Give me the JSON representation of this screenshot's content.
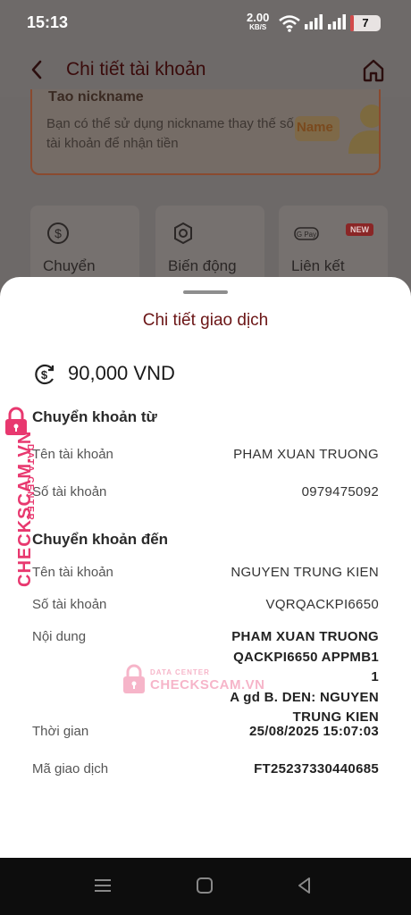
{
  "status_bar": {
    "time": "15:13",
    "speed_value": "2.00",
    "speed_unit": "KB/S",
    "battery": "7",
    "battery_level": 0.07,
    "icons": [
      "wifi-icon",
      "signal-icon",
      "signal-icon",
      "battery-icon"
    ]
  },
  "header": {
    "title": "Chi tiết tài khoản",
    "back_icon": "back-arrow-icon",
    "home_icon": "home-icon"
  },
  "background": {
    "nickname_card": {
      "partial_title": "Tạo nickname",
      "description": "Bạn có thể sử dụng nickname thay thế số tài khoản để nhận tiền",
      "badge": "Name"
    },
    "services": [
      {
        "label": "Chuyển",
        "icon": "transfer-icon"
      },
      {
        "label": "Biến động",
        "icon": "settings-icon"
      },
      {
        "label": "Liên kết",
        "icon": "gpay-icon",
        "badge": "NEW"
      }
    ]
  },
  "sheet": {
    "title": "Chi tiết giao dịch",
    "amount": "90,000 VND",
    "from_section": "Chuyển khoản từ",
    "from_name_label": "Tên tài khoản",
    "from_name": "PHAM XUAN TRUONG",
    "from_account_label": "Số tài khoản",
    "from_account": "0979475092",
    "to_section": "Chuyển khoản đến",
    "to_name_label": "Tên tài khoản",
    "to_name": "NGUYEN TRUNG KIEN",
    "to_account_label": "Số tài khoản",
    "to_account": "VQRQACKPI6650",
    "memo_label": "Nội dung",
    "memo_lines": [
      "PHAM XUAN TRUONG",
      "QACKPI6650  APPMB1 1",
      "A gd B. DEN: NGUYEN",
      "TRUNG KIEN"
    ],
    "time_label": "Thời gian",
    "time": "25/08/2025 15:07:03",
    "txid_label": "Mã giao dịch",
    "txid": "FT25237330440685"
  },
  "watermark": {
    "brand": "CHECKSCAM.VN",
    "sub": "DATA CENTER"
  },
  "colors": {
    "title": "#6b1516",
    "watermark": "#e8386f",
    "accent": "#8a2626"
  }
}
